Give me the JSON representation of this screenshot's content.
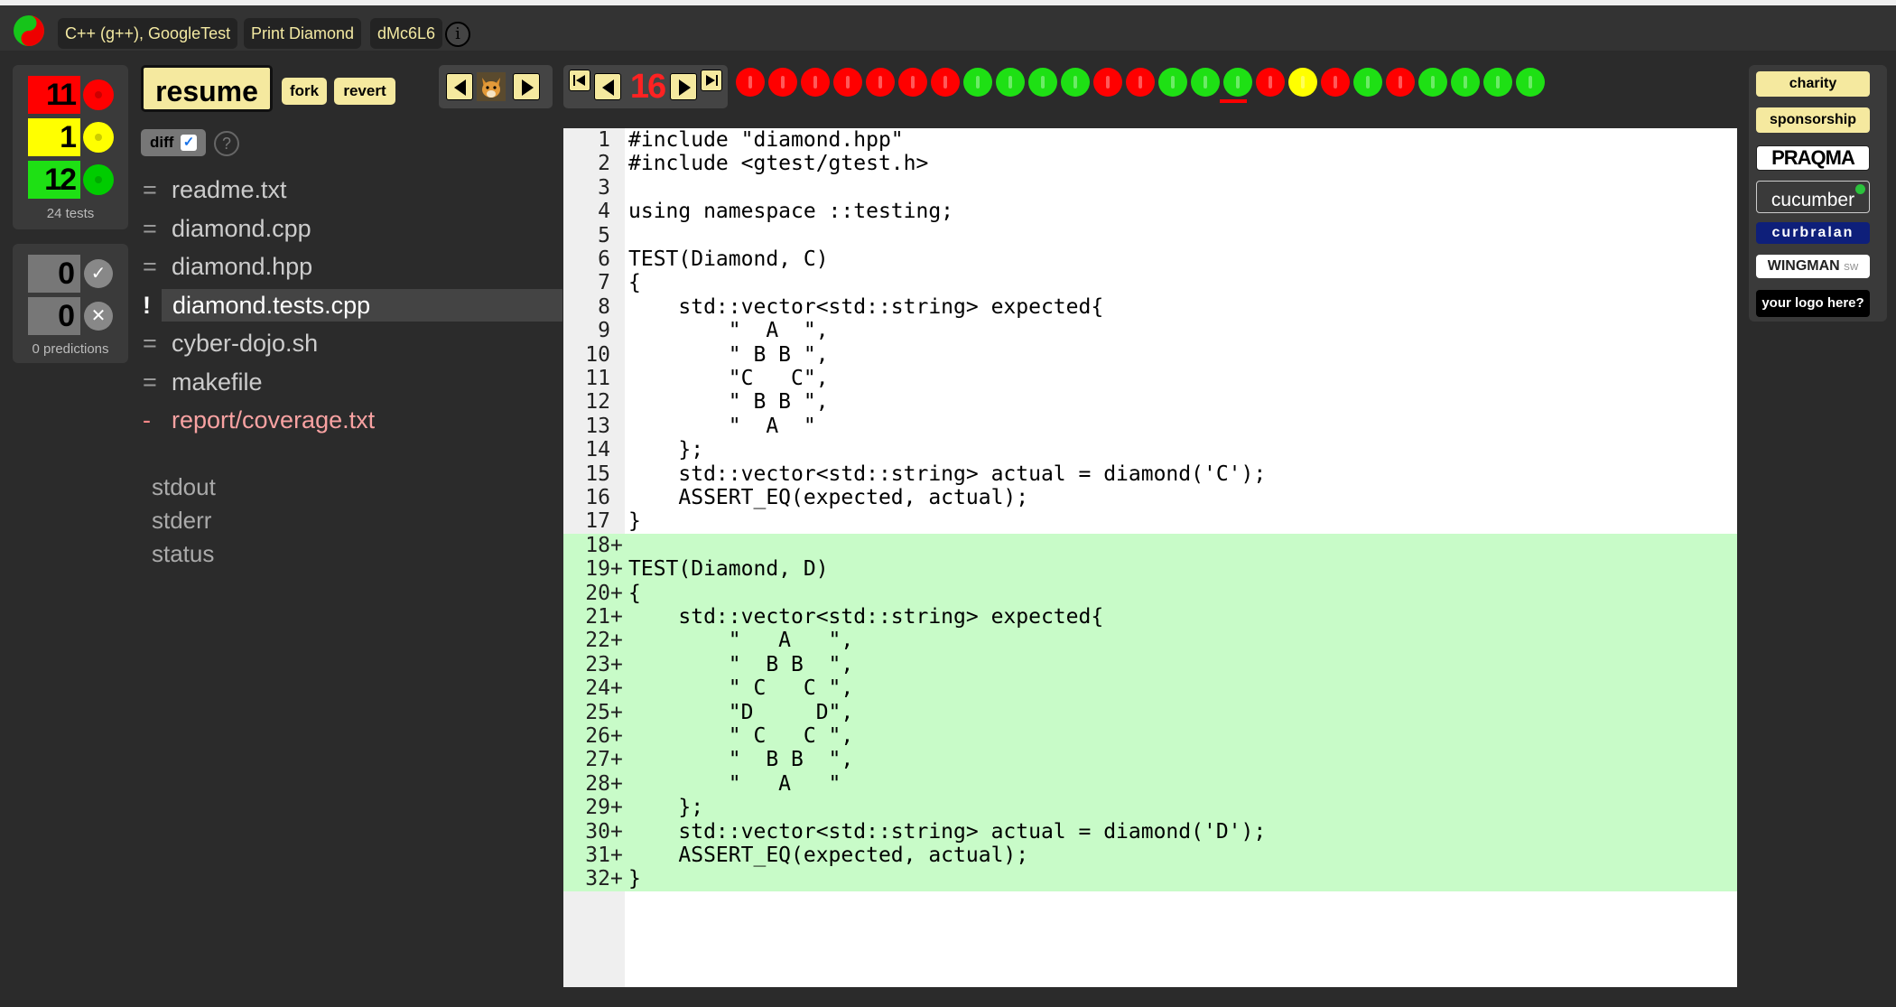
{
  "header": {
    "language": "C++ (g++), GoogleTest",
    "exercise": "Print Diamond",
    "id": "dMc6L6",
    "info_icon": "i"
  },
  "traffic_summary": {
    "red_count": "11",
    "amber_count": "1",
    "green_count": "12",
    "tests_label": "24 tests"
  },
  "predictions": {
    "correct_count": "0",
    "incorrect_count": "0",
    "label": "0 predictions"
  },
  "actions": {
    "resume": "resume",
    "fork": "fork",
    "revert": "revert",
    "diff": "diff",
    "help": "?"
  },
  "navigation": {
    "current_index": "16"
  },
  "traffic_lights": [
    "red",
    "red",
    "red",
    "red",
    "red",
    "red",
    "red",
    "green",
    "green",
    "green",
    "green",
    "red",
    "red",
    "green",
    "green",
    "green",
    "red",
    "yellow",
    "red",
    "green",
    "red",
    "green",
    "green",
    "green",
    "green"
  ],
  "files": [
    {
      "marker": "=",
      "name": "readme.txt"
    },
    {
      "marker": "=",
      "name": "diamond.cpp"
    },
    {
      "marker": "=",
      "name": "diamond.hpp"
    },
    {
      "marker": "!",
      "name": "diamond.tests.cpp"
    },
    {
      "marker": "=",
      "name": "cyber-dojo.sh"
    },
    {
      "marker": "=",
      "name": "makefile"
    },
    {
      "marker": "-",
      "name": "report/coverage.txt"
    }
  ],
  "outputs": [
    "stdout",
    "stderr",
    "status"
  ],
  "code": [
    {
      "n": "1",
      "t": "#include \"diamond.hpp\""
    },
    {
      "n": "2",
      "t": "#include <gtest/gtest.h>"
    },
    {
      "n": "3",
      "t": ""
    },
    {
      "n": "4",
      "t": "using namespace ::testing;"
    },
    {
      "n": "5",
      "t": ""
    },
    {
      "n": "6",
      "t": "TEST(Diamond, C)"
    },
    {
      "n": "7",
      "t": "{"
    },
    {
      "n": "8",
      "t": "    std::vector<std::string> expected{"
    },
    {
      "n": "9",
      "t": "        \"  A  \","
    },
    {
      "n": "10",
      "t": "        \" B B \","
    },
    {
      "n": "11",
      "t": "        \"C   C\","
    },
    {
      "n": "12",
      "t": "        \" B B \","
    },
    {
      "n": "13",
      "t": "        \"  A  \""
    },
    {
      "n": "14",
      "t": "    };"
    },
    {
      "n": "15",
      "t": "    std::vector<std::string> actual = diamond('C');"
    },
    {
      "n": "16",
      "t": "    ASSERT_EQ(expected, actual);"
    },
    {
      "n": "17",
      "t": "}"
    },
    {
      "n": "18",
      "t": "",
      "added": true
    },
    {
      "n": "19",
      "t": "TEST(Diamond, D)",
      "added": true
    },
    {
      "n": "20",
      "t": "{",
      "added": true
    },
    {
      "n": "21",
      "t": "    std::vector<std::string> expected{",
      "added": true
    },
    {
      "n": "22",
      "t": "        \"   A   \",",
      "added": true
    },
    {
      "n": "23",
      "t": "        \"  B B  \",",
      "added": true
    },
    {
      "n": "24",
      "t": "        \" C   C \",",
      "added": true
    },
    {
      "n": "25",
      "t": "        \"D     D\",",
      "added": true
    },
    {
      "n": "26",
      "t": "        \" C   C \",",
      "added": true
    },
    {
      "n": "27",
      "t": "        \"  B B  \",",
      "added": true
    },
    {
      "n": "28",
      "t": "        \"   A   \"",
      "added": true
    },
    {
      "n": "29",
      "t": "    };",
      "added": true
    },
    {
      "n": "30",
      "t": "    std::vector<std::string> actual = diamond('D');",
      "added": true
    },
    {
      "n": "31",
      "t": "    ASSERT_EQ(expected, actual);",
      "added": true
    },
    {
      "n": "32",
      "t": "}",
      "added": true
    }
  ],
  "sponsors": {
    "charity": "charity",
    "sponsorship": "sponsorship",
    "praqma": "PRAQMA",
    "cucumber": "cucumber",
    "curbralan": "curbralan",
    "wingman": "WINGMAN",
    "wingman_suffix": "SW",
    "your_logo": "your logo here?"
  },
  "colors": {
    "red": "#ff0000",
    "amber": "#ffff00",
    "green": "#1ee014",
    "button_yellow": "#f5e99f",
    "diff_added": "#c8fbc8"
  }
}
